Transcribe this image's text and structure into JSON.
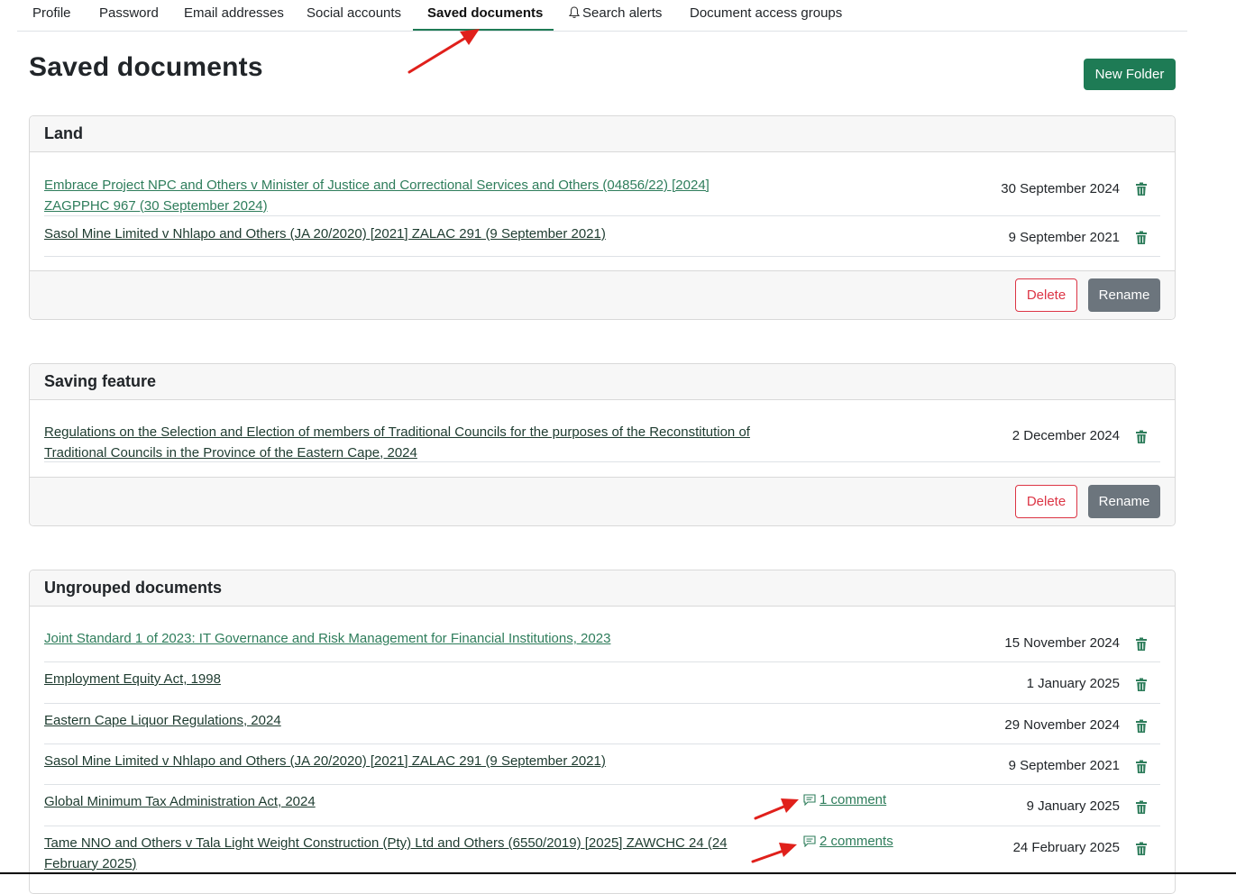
{
  "tabs": [
    {
      "label": "Profile"
    },
    {
      "label": "Password"
    },
    {
      "label": "Email addresses"
    },
    {
      "label": "Social accounts"
    },
    {
      "label": "Saved documents"
    },
    {
      "label": "Search alerts",
      "icon": "bell-icon"
    },
    {
      "label": "Document access groups"
    }
  ],
  "page": {
    "title": "Saved documents",
    "new_folder_label": "New Folder"
  },
  "folders": [
    {
      "name": "Land",
      "delete_label": "Delete",
      "rename_label": "Rename",
      "documents": [
        {
          "title": "Embrace Project NPC and Others v Minister of Justice and Correctional Services and Others (04856/22) [2024] ZAGPPHC 967 (30 September 2024)",
          "date": "30 September 2024"
        },
        {
          "title": "Sasol Mine Limited v Nhlapo and Others (JA 20/2020) [2021] ZALAC 291 (9 September 2021)",
          "date": "9 September 2021"
        }
      ]
    },
    {
      "name": "Saving feature",
      "delete_label": "Delete",
      "rename_label": "Rename",
      "documents": [
        {
          "title": "Regulations on the Selection and Election of members of Traditional Councils for the purposes of the Reconstitution of Traditional Councils in the Province of the Eastern Cape, 2024",
          "date": "2 December 2024"
        }
      ]
    },
    {
      "name": "Ungrouped documents",
      "documents": [
        {
          "title": "Joint Standard 1 of 2023: IT Governance and Risk Management for Financial Institutions, 2023",
          "date": "15 November 2024"
        },
        {
          "title": "Employment Equity Act, 1998",
          "date": "1 January 2025"
        },
        {
          "title": "Eastern Cape Liquor Regulations, 2024",
          "date": "29 November 2024"
        },
        {
          "title": "Sasol Mine Limited v Nhlapo and Others (JA 20/2020) [2021] ZALAC 291 (9 September 2021)",
          "date": "9 September 2021"
        },
        {
          "title": "Global Minimum Tax Administration Act, 2024",
          "date": "9 January 2025",
          "comments": "1 comment"
        },
        {
          "title": "Tame NNO and Others v Tala Light Weight Construction (Pty) Ltd and Others (6550/2019) [2025] ZAWCHC 24 (24 February 2025)",
          "date": "24 February 2025",
          "comments": "2 comments"
        }
      ]
    }
  ],
  "colors": {
    "accent": "#1e7b55",
    "danger": "#dc3545",
    "secondary": "#6c757d",
    "annotation_arrow": "#e0201b"
  }
}
